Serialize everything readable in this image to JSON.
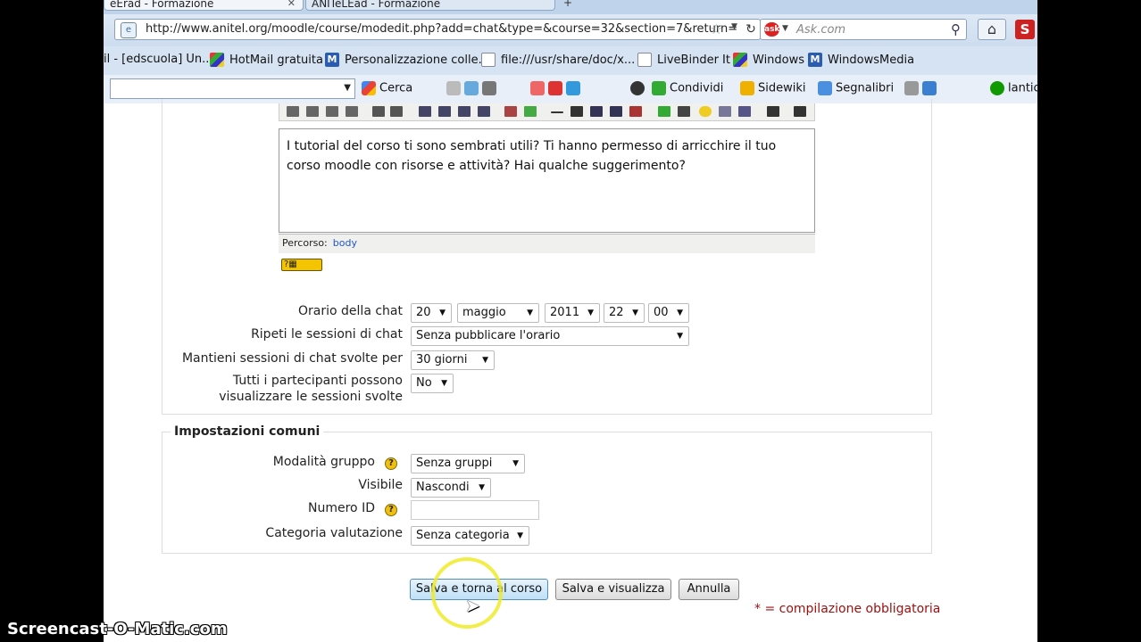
{
  "browser": {
    "tabs": [
      {
        "label": "eErad - Formazione",
        "active": true
      },
      {
        "label": "ANITeLEad - Formazione",
        "active": false
      }
    ],
    "url": "http://www.anitel.org/moodle/course/modedit.php?add=chat&type=&course=32&section=7&return=",
    "search_placeholder": "Ask.com",
    "ask_badge": "ask",
    "extension_letter": "S"
  },
  "bookmarks": [
    {
      "label": "il - [edscuola] Un...",
      "icon": "windows-icon"
    },
    {
      "label": "HotMail gratuita",
      "icon": "windows-icon"
    },
    {
      "label": "Personalizzazione colle...",
      "icon": "moodle-icon"
    },
    {
      "label": "file:///usr/share/doc/x...",
      "icon": "document-icon"
    },
    {
      "label": "LiveBinder It",
      "icon": "document-icon"
    },
    {
      "label": "Windows",
      "icon": "windows-icon"
    },
    {
      "label": "WindowsMedia",
      "icon": "moodle-icon"
    }
  ],
  "toolbar": {
    "search_label": "Cerca",
    "share_label": "Condividi",
    "sidewiki_label": "Sidewiki",
    "bookmarks_label": "Segnalibri",
    "user_label": "lantic"
  },
  "editor": {
    "text": "I tutorial del corso ti sono sembrati utili? Ti hanno permesso di arricchire il tuo corso moodle con risorse e attività? Hai qualche suggerimento?",
    "path_label": "Percorso:",
    "path_value": "body"
  },
  "chat": {
    "time_label": "Orario della chat",
    "day": "20",
    "month": "maggio",
    "year": "2011",
    "hour": "22",
    "minute": "00",
    "repeat_label": "Ripeti le sessioni di chat",
    "repeat_value": "Senza pubblicare l'orario",
    "keep_label": "Mantieni sessioni di chat svolte per",
    "keep_value": "30 giorni",
    "view_label_1": "Tutti i partecipanti possono",
    "view_label_2": "visualizzare le sessioni svolte",
    "view_value": "No"
  },
  "common": {
    "legend": "Impostazioni comuni",
    "group_label": "Modalità gruppo",
    "group_value": "Senza gruppi",
    "visible_label": "Visibile",
    "visible_value": "Nascondi",
    "id_label": "Numero ID",
    "id_value": "",
    "grade_label": "Categoria valutazione",
    "grade_value": "Senza categoria"
  },
  "actions": {
    "save_return": "Salva e torna al corso",
    "save_view": "Salva e visualizza",
    "cancel": "Annulla",
    "required_note": "* = compilazione obbligatoria"
  },
  "watermark": "Screencast-O-Matic.com"
}
